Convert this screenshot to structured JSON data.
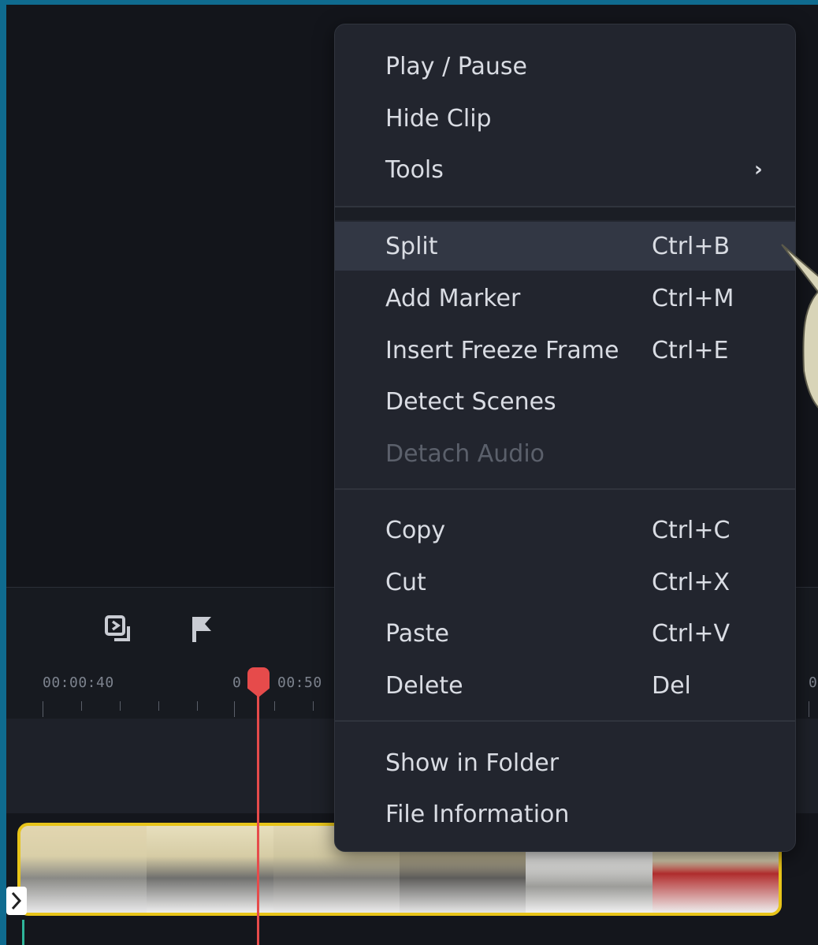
{
  "timeline": {
    "ticks": [
      "00:00:40",
      "0",
      "00:50",
      "0"
    ]
  },
  "icons": {
    "toolbar": [
      "insert-clip-icon",
      "flag-marker-icon"
    ],
    "arrow": "chevron-right-icon"
  },
  "colors": {
    "background_frame": "#0f6b8f",
    "menu_bg": "#22252e",
    "menu_highlight": "#323744",
    "playhead": "#e64b4b",
    "clip_border": "#e8c419",
    "disabled_text": "#5b606b"
  },
  "context_menu": {
    "group1": [
      {
        "label": "Play / Pause"
      },
      {
        "label": "Hide Clip"
      },
      {
        "label": "Tools",
        "arrow": "›"
      }
    ],
    "group2": [
      {
        "label": "Split",
        "shortcut": "Ctrl+B",
        "highlighted": true
      },
      {
        "label": "Add Marker",
        "shortcut": "Ctrl+M"
      },
      {
        "label": "Insert Freeze Frame",
        "shortcut": "Ctrl+E"
      },
      {
        "label": "Detect Scenes"
      },
      {
        "label": "Detach Audio",
        "disabled": true
      }
    ],
    "group3": [
      {
        "label": "Copy",
        "shortcut": "Ctrl+C"
      },
      {
        "label": "Cut",
        "shortcut": "Ctrl+X"
      },
      {
        "label": "Paste",
        "shortcut": "Ctrl+V"
      },
      {
        "label": "Delete",
        "shortcut": "Del"
      }
    ],
    "group4": [
      {
        "label": "Show in Folder"
      },
      {
        "label": "File Information"
      }
    ]
  }
}
